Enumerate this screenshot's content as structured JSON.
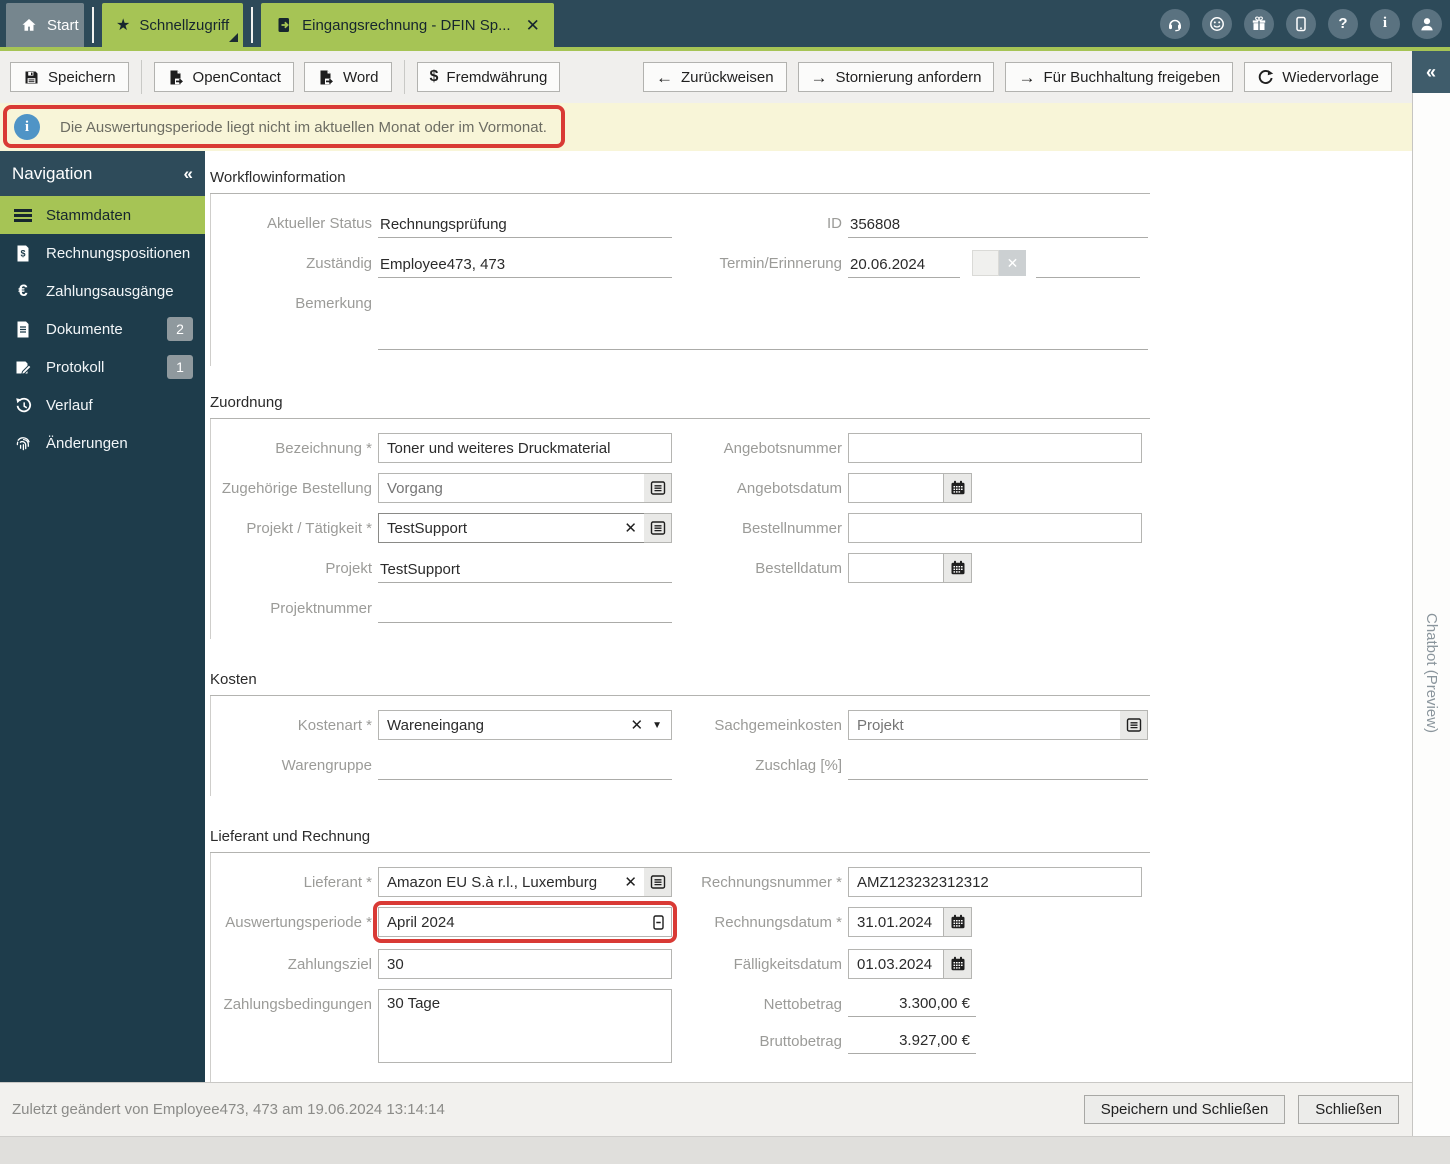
{
  "colors": {
    "accent_green": "#a6c455",
    "topbar_bg": "#2d4a59",
    "sidebar_bg": "#1e3c4b",
    "banner_yellow": "#f8f5d8",
    "highlight_red": "#d93a35",
    "info_blue": "#4f94c6"
  },
  "topbar": {
    "tabs": [
      {
        "label": "Start",
        "icon": "home-icon"
      },
      {
        "label": "Schnellzugriff",
        "icon": "star-icon"
      },
      {
        "label": "Eingangsrechnung - DFIN Sp...",
        "icon": "document-icon"
      }
    ],
    "icons": [
      "headset",
      "smiley",
      "gift",
      "mobile",
      "help",
      "info",
      "user"
    ]
  },
  "toolbar": {
    "save": "Speichern",
    "opencontact": "OpenContact",
    "word": "Word",
    "fremdwaehrung": "Fremdwährung",
    "zurueckweisen": "Zurückweisen",
    "stornierung": "Stornierung anfordern",
    "freigeben": "Für Buchhaltung freigeben",
    "wiedervorlage": "Wiedervorlage"
  },
  "banner": {
    "text": "Die Auswertungsperiode liegt nicht im aktuellen Monat oder im Vormonat."
  },
  "sidebar": {
    "title": "Navigation",
    "items": [
      {
        "label": "Stammdaten",
        "icon": "menu-icon",
        "active": true
      },
      {
        "label": "Rechnungspositionen",
        "icon": "invoice-icon"
      },
      {
        "label": "Zahlungsausgänge",
        "icon": "euro-icon"
      },
      {
        "label": "Dokumente",
        "icon": "document-icon",
        "badge": "2"
      },
      {
        "label": "Protokoll",
        "icon": "protocol-icon",
        "badge": "1"
      },
      {
        "label": "Verlauf",
        "icon": "history-icon"
      },
      {
        "label": "Änderungen",
        "icon": "fingerprint-icon"
      }
    ]
  },
  "form": {
    "workflow": {
      "title": "Workflowinformation",
      "aktueller_status": {
        "label": "Aktueller Status",
        "value": "Rechnungsprüfung"
      },
      "id": {
        "label": "ID",
        "value": "356808"
      },
      "zustaendig": {
        "label": "Zuständig",
        "value": "Employee473, 473"
      },
      "termin": {
        "label": "Termin/Erinnerung",
        "value": "20.06.2024"
      },
      "bemerkung": {
        "label": "Bemerkung",
        "value": ""
      }
    },
    "zuordnung": {
      "title": "Zuordnung",
      "bezeichnung": {
        "label": "Bezeichnung *",
        "value": "Toner und weiteres Druckmaterial"
      },
      "zugehoerige_bestellung": {
        "label": "Zugehörige Bestellung",
        "placeholder": "Vorgang"
      },
      "projekt_taetigkeit": {
        "label": "Projekt / Tätigkeit *",
        "value": "TestSupport"
      },
      "projekt": {
        "label": "Projekt",
        "value": "TestSupport"
      },
      "projektnummer": {
        "label": "Projektnummer",
        "value": ""
      },
      "angebotsnummer": {
        "label": "Angebotsnummer",
        "value": ""
      },
      "angebotsdatum": {
        "label": "Angebotsdatum",
        "value": ""
      },
      "bestellnummer": {
        "label": "Bestellnummer",
        "value": ""
      },
      "bestelldatum": {
        "label": "Bestelldatum",
        "value": ""
      }
    },
    "kosten": {
      "title": "Kosten",
      "kostenart": {
        "label": "Kostenart *",
        "value": "Wareneingang"
      },
      "warengruppe": {
        "label": "Warengruppe",
        "value": ""
      },
      "sachgemeinkosten": {
        "label": "Sachgemeinkosten",
        "placeholder": "Projekt"
      },
      "zuschlag": {
        "label": "Zuschlag [%]",
        "value": ""
      }
    },
    "lieferant": {
      "title": "Lieferant und Rechnung",
      "lieferant": {
        "label": "Lieferant *",
        "value": "Amazon EU S.à r.l., Luxemburg"
      },
      "auswertungsperiode": {
        "label": "Auswertungsperiode *",
        "value": "April 2024"
      },
      "zahlungsziel": {
        "label": "Zahlungsziel",
        "value": "30"
      },
      "zahlungsbedingungen": {
        "label": "Zahlungsbedingungen",
        "value": "30 Tage"
      },
      "rechnungsnummer": {
        "label": "Rechnungsnummer *",
        "value": "AMZ123232312312"
      },
      "rechnungsdatum": {
        "label": "Rechnungsdatum *",
        "value": "31.01.2024"
      },
      "faelligkeitsdatum": {
        "label": "Fälligkeitsdatum",
        "value": "01.03.2024"
      },
      "nettobetrag": {
        "label": "Nettobetrag",
        "value": "3.300,00 €"
      },
      "bruttobetrag": {
        "label": "Bruttobetrag",
        "value": "3.927,00 €"
      }
    }
  },
  "chatbot_panel": {
    "label": "Chatbot (Preview)"
  },
  "footer": {
    "status": "Zuletzt geändert von Employee473, 473 am 19.06.2024 13:14:14",
    "save_close": "Speichern und Schließen",
    "close": "Schließen"
  }
}
